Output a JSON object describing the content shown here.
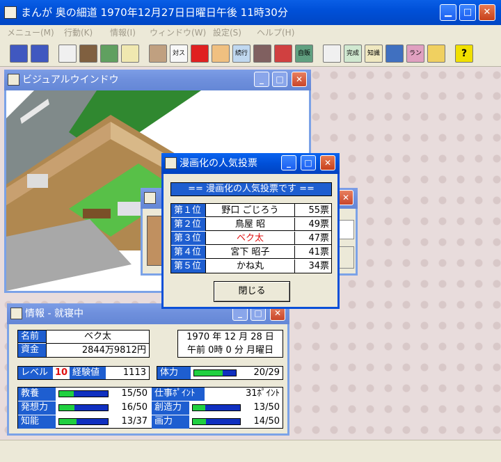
{
  "window": {
    "title": "まんが 奥の細道 1970年12月27日日曜日午後 11時30分"
  },
  "menu": [
    "メニュー(M)",
    "行動(K)",
    "情報(I)",
    "ウィンドウ(W)",
    "設定(S)",
    "ヘルプ(H)"
  ],
  "toolbar": {
    "labels": [
      "対スケ",
      "続行",
      "自販",
      "完成後",
      "知識",
      "ランキング",
      "?"
    ]
  },
  "visual_window": {
    "title": "ビジュアルウインドウ"
  },
  "poll_window": {
    "title": "漫画化の人気投票",
    "header": "== 漫画化の人気投票です ==",
    "rows": [
      {
        "rank": "第１位",
        "name": "野口 ごじろう",
        "votes": "55票"
      },
      {
        "rank": "第２位",
        "name": "鳥屋 昭",
        "votes": "49票"
      },
      {
        "rank": "第３位",
        "name": "ベク太",
        "votes": "47票"
      },
      {
        "rank": "第４位",
        "name": "宮下 昭子",
        "votes": "41票"
      },
      {
        "rank": "第５位",
        "name": "かね丸",
        "votes": "34票"
      }
    ],
    "highlight_color": "#e01010",
    "close_label": "閉じる"
  },
  "info_window": {
    "title": "情報 - 就寝中",
    "name_label": "名前",
    "name": "ベク太",
    "funds_label": "資金",
    "funds": "2844万9812円",
    "date": "1970 年 12 月 28 日",
    "time": "午前 0時 0 分 月曜日",
    "level_label": "レベル",
    "level": "10",
    "exp_label": "経験値",
    "exp": "1113",
    "stamina_label": "体力",
    "stamina": "20/29",
    "stats": [
      {
        "label": "教養",
        "value": "15/50",
        "fill": 0.3
      },
      {
        "label": "仕事ﾎﾟｲﾝﾄ",
        "value": "31ﾎﾟｲﾝﾄ"
      },
      {
        "label": "発想力",
        "value": "16/50",
        "fill": 0.32
      },
      {
        "label": "創造力",
        "value": "13/50",
        "fill": 0.26
      },
      {
        "label": "知能",
        "value": "13/37",
        "fill": 0.35
      },
      {
        "label": "画力",
        "value": "14/50",
        "fill": 0.28
      }
    ],
    "stamina_fill": 0.69
  },
  "colors": {
    "accent": "#1e5ed0",
    "titlebar": "#0050d8"
  }
}
